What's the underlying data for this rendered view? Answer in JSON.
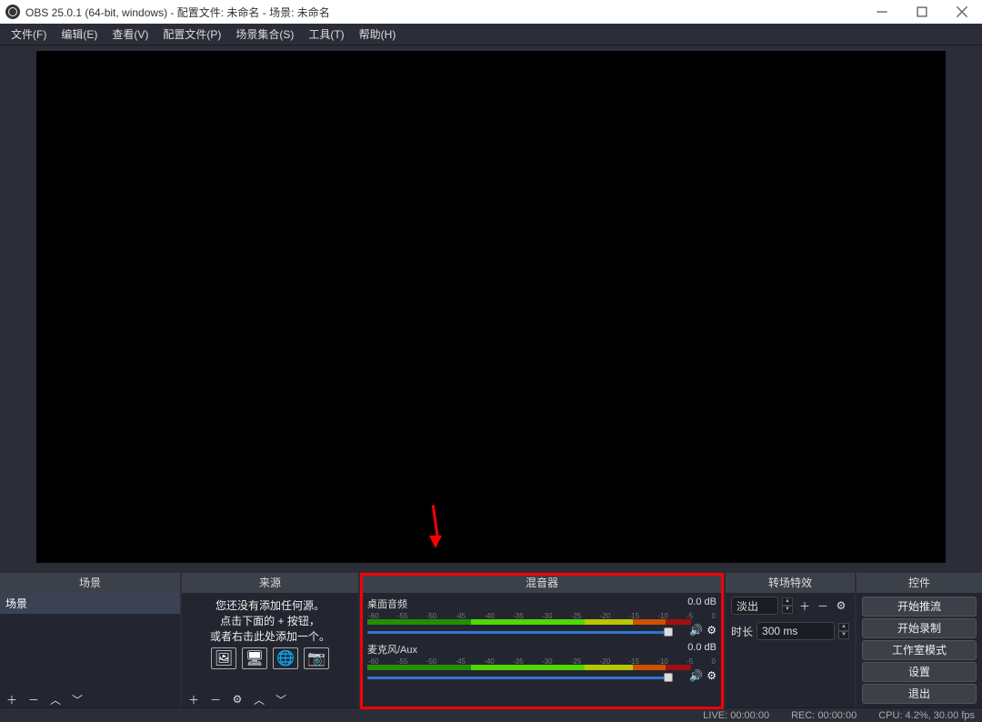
{
  "titlebar": {
    "text": "OBS 25.0.1 (64-bit, windows) - 配置文件: 未命名 - 场景: 未命名"
  },
  "menu": {
    "file": "文件(F)",
    "edit": "编辑(E)",
    "view": "查看(V)",
    "profile": "配置文件(P)",
    "sceneCollection": "场景集合(S)",
    "tools": "工具(T)",
    "help": "帮助(H)"
  },
  "panels": {
    "scenes": {
      "title": "场景",
      "items": [
        "场景"
      ]
    },
    "sources": {
      "title": "来源",
      "emptyLine1": "您还没有添加任何源。",
      "emptyLine2": "点击下面的 + 按钮，",
      "emptyLine3": "或者右击此处添加一个。"
    },
    "mixer": {
      "title": "混音器",
      "channels": [
        {
          "name": "桌面音频",
          "level": "0.0 dB"
        },
        {
          "name": "麦克风/Aux",
          "level": "0.0 dB"
        }
      ]
    },
    "transitions": {
      "title": "转场特效",
      "select": "淡出",
      "durationLabel": "时长",
      "durationValue": "300 ms"
    },
    "controls": {
      "title": "控件",
      "buttons": [
        "开始推流",
        "开始录制",
        "工作室模式",
        "设置",
        "退出"
      ]
    }
  },
  "status": {
    "live": "LIVE: 00:00:00",
    "rec": "REC: 00:00:00",
    "cpu": "CPU: 4.2%, 30.00 fps"
  }
}
